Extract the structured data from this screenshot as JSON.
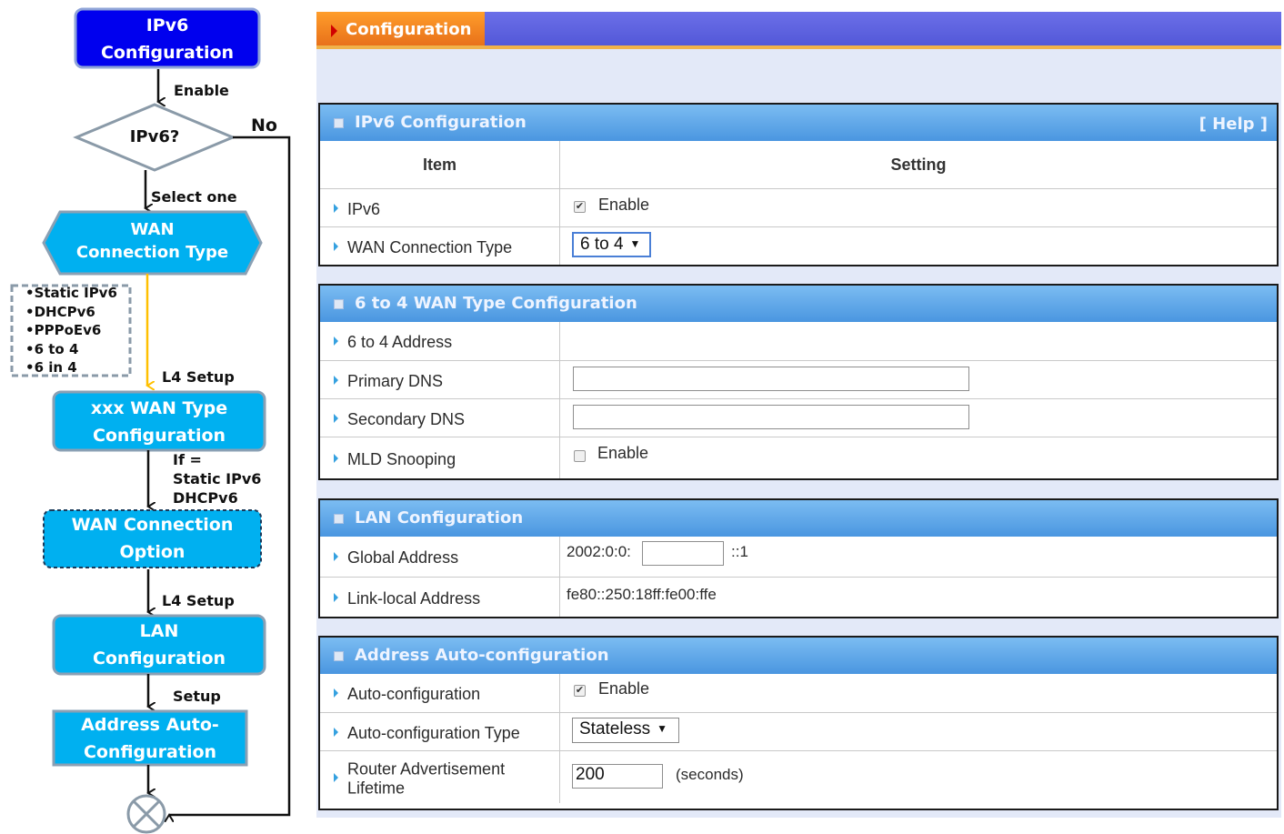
{
  "flowchart": {
    "start": {
      "line1": "IPv6",
      "line2": "Configuration"
    },
    "edge_enable": "Enable",
    "decision": "IPv6?",
    "edge_no": "No",
    "edge_select": "Select one",
    "wan_type": {
      "line1": "WAN",
      "line2": "Connection Type"
    },
    "types": [
      "•Static IPv6",
      "•DHCPv6",
      "•PPPoEv6",
      "•6 to 4",
      "•6 in 4"
    ],
    "edge_l4_1": "L4 Setup",
    "xxx_wan": {
      "line1": "xxx WAN Type",
      "line2": "Configuration"
    },
    "edge_if": {
      "line1": "If =",
      "line2": "Static IPv6",
      "line3": "DHCPv6"
    },
    "wan_option": {
      "line1": "WAN Connection",
      "line2": "Option"
    },
    "edge_l4_2": "L4 Setup",
    "lan": {
      "line1": "LAN",
      "line2": "Configuration"
    },
    "edge_setup": "Setup",
    "auto": {
      "line1": "Address Auto-",
      "line2": "Configuration"
    },
    "colors": {
      "start": "#0000ee",
      "process": "#00b0f0",
      "accent": "#ffc000"
    }
  },
  "header": {
    "title": "Configuration"
  },
  "ipv6_panel": {
    "title": "IPv6 Configuration",
    "help": "[ Help ]",
    "col_item": "Item",
    "col_setting": "Setting",
    "ipv6_label": "IPv6",
    "ipv6_enable_label": "Enable",
    "ipv6_enabled": true,
    "wan_type_label": "WAN Connection Type",
    "wan_type_value": "6 to 4"
  },
  "sixto4_panel": {
    "title": "6 to 4 WAN Type Configuration",
    "address_label": "6 to 4 Address",
    "address_value": "",
    "primary_dns_label": "Primary DNS",
    "primary_dns_value": "",
    "secondary_dns_label": "Secondary DNS",
    "secondary_dns_value": "",
    "mld_label": "MLD Snooping",
    "mld_enable_label": "Enable",
    "mld_enabled": false
  },
  "lan_panel": {
    "title": "LAN Configuration",
    "global_label": "Global Address",
    "global_prefix": "2002:0:0:",
    "global_value": "",
    "global_suffix": "::1",
    "link_label": "Link-local Address",
    "link_value": "fe80::250:18ff:fe00:ffe"
  },
  "auto_panel": {
    "title": "Address Auto-configuration",
    "auto_label": "Auto-configuration",
    "auto_enable_label": "Enable",
    "auto_enabled": true,
    "type_label": "Auto-configuration Type",
    "type_value": "Stateless",
    "lifetime_label_1": "Router Advertisement",
    "lifetime_label_2": "Lifetime",
    "lifetime_value": "200",
    "lifetime_unit": "(seconds)"
  }
}
